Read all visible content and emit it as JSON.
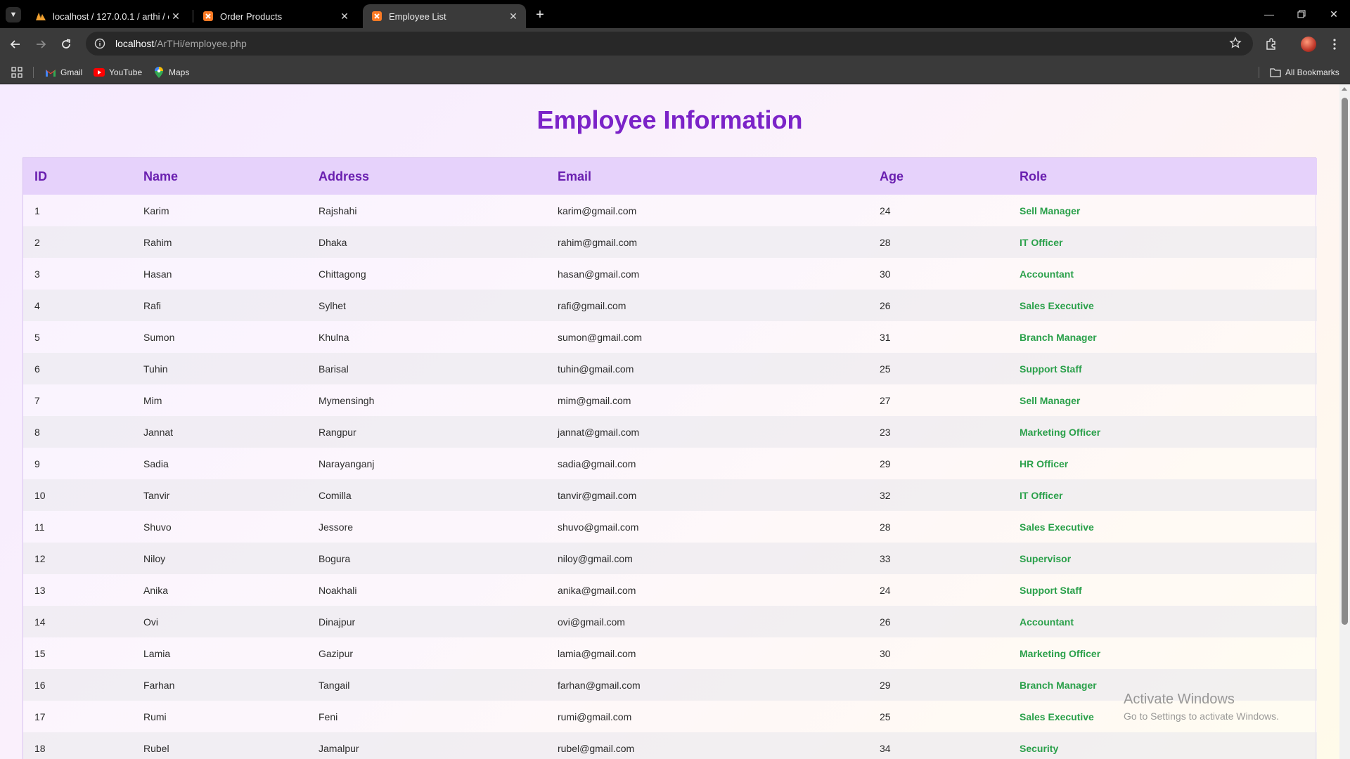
{
  "tabs": [
    {
      "title": "localhost / 127.0.0.1 / arthi / cu",
      "icon": "phpmyadmin-icon",
      "active": false
    },
    {
      "title": "Order Products",
      "icon": "xampp-icon",
      "active": false
    },
    {
      "title": "Employee List",
      "icon": "xampp-icon",
      "active": true
    }
  ],
  "address_bar": {
    "host": "localhost",
    "path": "/ArTHi/employee.php"
  },
  "bookmarks": [
    {
      "label": "Gmail",
      "icon": "gmail-icon"
    },
    {
      "label": "YouTube",
      "icon": "youtube-icon"
    },
    {
      "label": "Maps",
      "icon": "maps-icon"
    }
  ],
  "all_bookmarks_label": "All Bookmarks",
  "page": {
    "title": "Employee Information",
    "columns": [
      "ID",
      "Name",
      "Address",
      "Email",
      "Age",
      "Role"
    ],
    "rows": [
      [
        "1",
        "Karim",
        "Rajshahi",
        "karim@gmail.com",
        "24",
        "Sell Manager"
      ],
      [
        "2",
        "Rahim",
        "Dhaka",
        "rahim@gmail.com",
        "28",
        "IT Officer"
      ],
      [
        "3",
        "Hasan",
        "Chittagong",
        "hasan@gmail.com",
        "30",
        "Accountant"
      ],
      [
        "4",
        "Rafi",
        "Sylhet",
        "rafi@gmail.com",
        "26",
        "Sales Executive"
      ],
      [
        "5",
        "Sumon",
        "Khulna",
        "sumon@gmail.com",
        "31",
        "Branch Manager"
      ],
      [
        "6",
        "Tuhin",
        "Barisal",
        "tuhin@gmail.com",
        "25",
        "Support Staff"
      ],
      [
        "7",
        "Mim",
        "Mymensingh",
        "mim@gmail.com",
        "27",
        "Sell Manager"
      ],
      [
        "8",
        "Jannat",
        "Rangpur",
        "jannat@gmail.com",
        "23",
        "Marketing Officer"
      ],
      [
        "9",
        "Sadia",
        "Narayanganj",
        "sadia@gmail.com",
        "29",
        "HR Officer"
      ],
      [
        "10",
        "Tanvir",
        "Comilla",
        "tanvir@gmail.com",
        "32",
        "IT Officer"
      ],
      [
        "11",
        "Shuvo",
        "Jessore",
        "shuvo@gmail.com",
        "28",
        "Sales Executive"
      ],
      [
        "12",
        "Niloy",
        "Bogura",
        "niloy@gmail.com",
        "33",
        "Supervisor"
      ],
      [
        "13",
        "Anika",
        "Noakhali",
        "anika@gmail.com",
        "24",
        "Support Staff"
      ],
      [
        "14",
        "Ovi",
        "Dinajpur",
        "ovi@gmail.com",
        "26",
        "Accountant"
      ],
      [
        "15",
        "Lamia",
        "Gazipur",
        "lamia@gmail.com",
        "30",
        "Marketing Officer"
      ],
      [
        "16",
        "Farhan",
        "Tangail",
        "farhan@gmail.com",
        "29",
        "Branch Manager"
      ],
      [
        "17",
        "Rumi",
        "Feni",
        "rumi@gmail.com",
        "25",
        "Sales Executive"
      ],
      [
        "18",
        "Rubel",
        "Jamalpur",
        "rubel@gmail.com",
        "34",
        "Security"
      ]
    ]
  },
  "watermark": {
    "line1": "Activate Windows",
    "line2": "Go to Settings to activate Windows."
  },
  "colors": {
    "title": "#7b23c8",
    "header_bg": "#e6d2fb",
    "header_text": "#6a1fb0",
    "role_text": "#2aa04a"
  }
}
